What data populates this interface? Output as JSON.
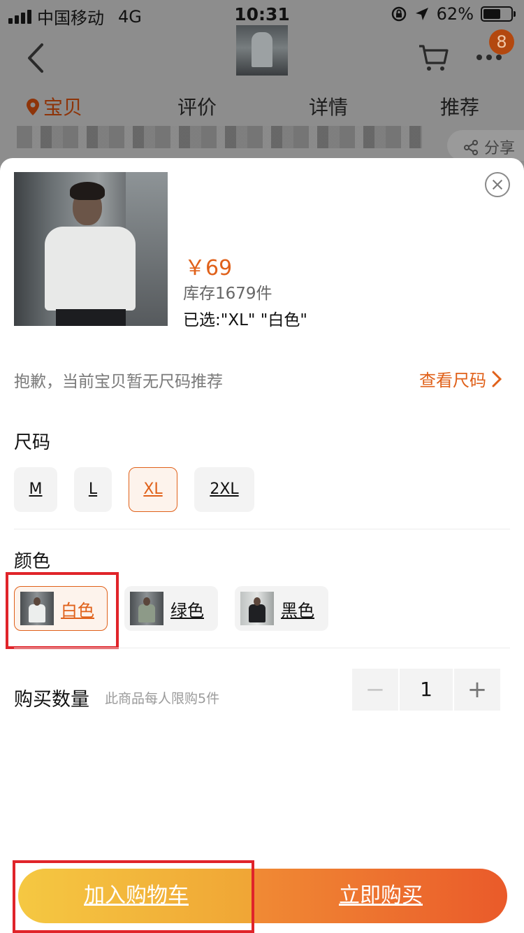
{
  "status_bar": {
    "carrier": "中国移动",
    "network": "4G",
    "time": "10:31",
    "battery": "62%",
    "battery_level": 0.62
  },
  "nav": {
    "cart_badge": "8",
    "tabs": [
      "宝贝",
      "评价",
      "详情",
      "推荐"
    ],
    "share_label": "分享"
  },
  "product": {
    "price": "￥69",
    "stock": "库存1679件",
    "selected": "已选:\"XL\" \"白色\""
  },
  "size_hint": "抱歉，当前宝贝暂无尺码推荐",
  "size_chart_link": "查看尺码",
  "size_section": {
    "title": "尺码",
    "options": [
      "M",
      "L",
      "XL",
      "2XL"
    ],
    "selected": "XL"
  },
  "color_section": {
    "title": "颜色",
    "options": [
      "白色",
      "绿色",
      "黑色"
    ],
    "selected": "白色"
  },
  "quantity": {
    "label": "购买数量",
    "limit_note": "此商品每人限购5件",
    "minus": "−",
    "value": "1",
    "plus": "+"
  },
  "actions": {
    "add_to_cart": "加入购物车",
    "buy_now": "立即购买"
  },
  "colors": {
    "accent": "#e0611a",
    "cart_button": "#f5c842",
    "buy_button": "#ea5a2a",
    "highlight_box": "#e0242a"
  }
}
